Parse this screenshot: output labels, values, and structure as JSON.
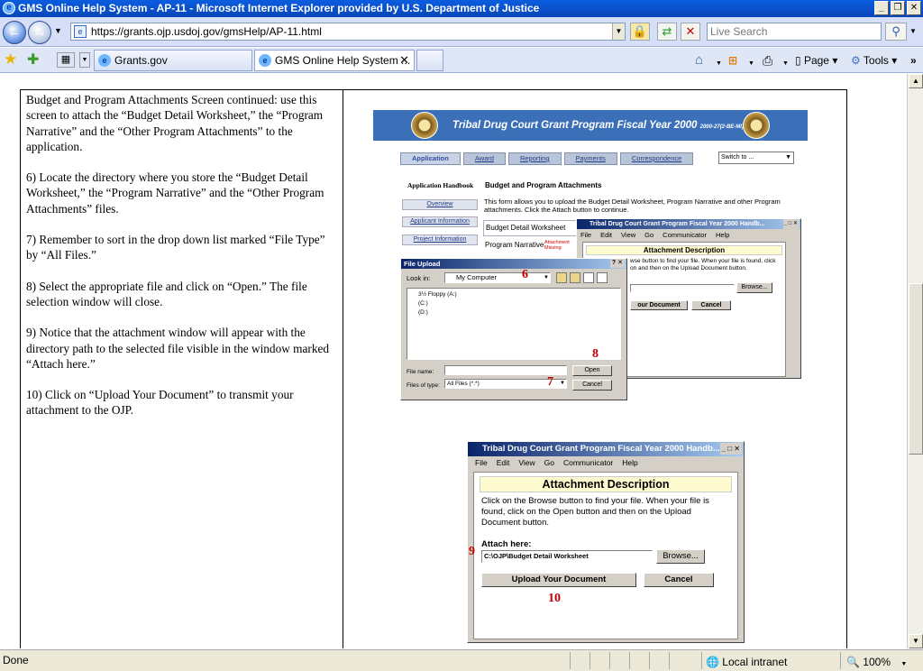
{
  "window": {
    "title": "GMS Online Help System - AP-11 - Microsoft Internet Explorer provided by U.S. Department of Justice"
  },
  "address": {
    "url": "https://grants.ojp.usdoj.gov/gmsHelp/AP-11.html",
    "search_placeholder": "Live Search"
  },
  "tabs": [
    {
      "label": "Grants.gov"
    },
    {
      "label": "GMS Online Help System ..."
    }
  ],
  "commands": {
    "page": "Page",
    "tools": "Tools"
  },
  "status": {
    "text": "Done",
    "zone": "Local intranet",
    "zoom": "100%"
  },
  "instructions": {
    "p1": "Budget and Program Attachments Screen continued:  use this screen to attach the “Budget Detail Worksheet,” the “Program Narrative” and the “Other Program Attachments” to the application.",
    "p2": "6)  Locate the directory where you store the “Budget Detail Worksheet,” the “Program Narrative” and the “Other Program Attachments” files.",
    "p3": "7) Remember to sort in the drop down list marked “File Type” by “All Files.”",
    "p4": "8) Select the appropriate file and click on “Open.”  The file selection window will close.",
    "p5": "9) Notice that the attachment window will appear with the directory path to the selected file visible in the window marked “Attach here.”",
    "p6": "10) Click on “Upload Your Document” to transmit your attachment to the OJP."
  },
  "shot1": {
    "banner": "Tribal Drug Court Grant Program Fiscal Year 2000",
    "banner_small": "2000-27(2-BE-MI)",
    "tabs": [
      "Application",
      "Award",
      "Reporting",
      "Payments",
      "Correspondence"
    ],
    "switch_to": "Switch to ...",
    "handbook": "Application Handbook",
    "section_title": "Budget and Program Attachments",
    "desc": "This form allows you to upload the Budget Detail Worksheet, Program Narrative and other Program attachments. Click the Attach button to continue.",
    "side_links": [
      "Overview",
      "Applicant Information",
      "Project Information"
    ],
    "rows": [
      "Budget Detail Worksheet",
      "Program Narrative"
    ],
    "attach_missing": "Attachment Missing",
    "win_title": "Tribal Drug Court Grant Program Fiscal Year 2000 Handb...",
    "menu": [
      "File",
      "Edit",
      "View",
      "Go",
      "Communicator",
      "Help"
    ],
    "attach_desc": "Attachment Description",
    "attach_text": "wse button to find your file. When your file is found, click on and then on the Upload Document button.",
    "browse": "Browse...",
    "upload_frag": "our Document",
    "cancel": "Cancel",
    "fileupload": {
      "title": "File Upload",
      "look_in": "Look in:",
      "location": "My Computer",
      "drives": [
        "3½ Floppy (A:)",
        "(C:)",
        "(D:)"
      ],
      "file_name_label": "File name:",
      "file_type_label": "Files of type:",
      "file_type": "All Files (*.*)",
      "open": "Open",
      "cancel": "Cancel"
    },
    "num6": "6",
    "num7": "7",
    "num8": "8"
  },
  "shot2": {
    "title": "Tribal Drug Court Grant Program Fiscal Year 2000 Handb...",
    "menu": [
      "File",
      "Edit",
      "View",
      "Go",
      "Communicator",
      "Help"
    ],
    "heading": "Attachment Description",
    "text": "Click on the Browse button to find your file. When your file is found, click on the Open button and then on the Upload Document button.",
    "attach_label": "Attach here:",
    "path": "C:\\OJP\\Budget Detail Worksheet",
    "browse": "Browse...",
    "upload": "Upload Your Document",
    "cancel": "Cancel",
    "num9": "9",
    "num10": "10"
  }
}
